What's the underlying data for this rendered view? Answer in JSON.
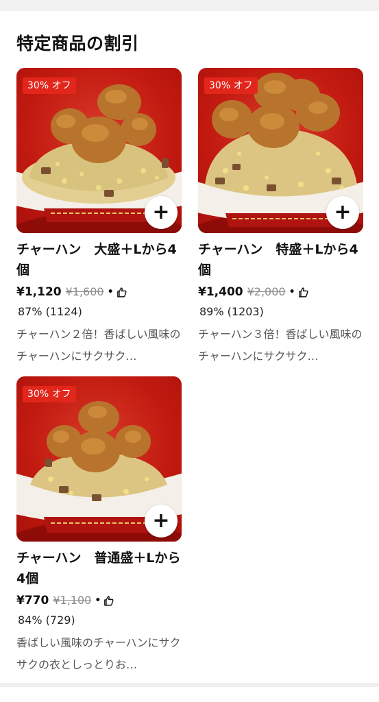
{
  "section": {
    "title": "特定商品の割引"
  },
  "colors": {
    "badge": "#e3261c",
    "image_bg": "#c21a10",
    "strike": "#8a8a8a"
  },
  "icons": {
    "add": "plus-icon",
    "rating": "thumbs-up-icon"
  },
  "products": [
    {
      "badge": "30% オフ",
      "name": "チャーハン　大盛＋Lから4個",
      "price": "¥1,120",
      "original_price": "¥1,600",
      "separator": "•",
      "rating": "87% (1124)",
      "description": "チャーハン２倍！香ばしい風味のチャーハンにサクサク…"
    },
    {
      "badge": "30% オフ",
      "name": "チャーハン　特盛＋Lから4個",
      "price": "¥1,400",
      "original_price": "¥2,000",
      "separator": "•",
      "rating": "89% (1203)",
      "description": "チャーハン３倍！香ばしい風味のチャーハンにサクサク…"
    },
    {
      "badge": "30% オフ",
      "name": "チャーハン　普通盛＋Lから4個",
      "price": "¥770",
      "original_price": "¥1,100",
      "separator": "•",
      "rating": "84% (729)",
      "description": "香ばしい風味のチャーハンにサクサクの衣としっとりお…"
    }
  ]
}
